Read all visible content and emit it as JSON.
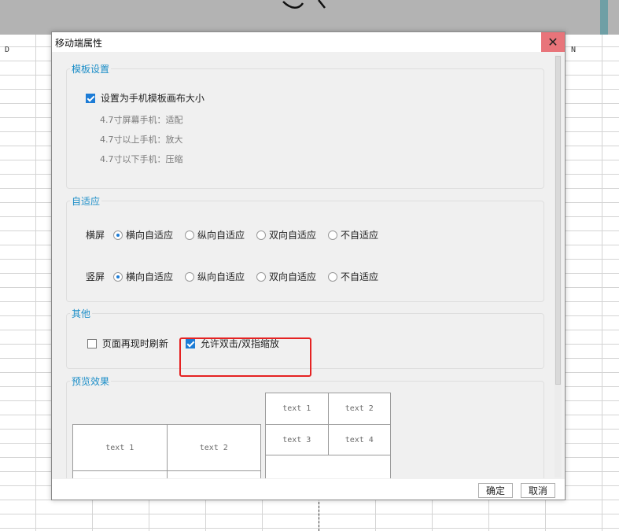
{
  "background": {
    "columns": {
      "d": "D",
      "n": "N"
    }
  },
  "dialog": {
    "title": "移动端属性",
    "close_glyph": "✕",
    "template": {
      "legend": "模板设置",
      "checkbox_label": "设置为手机模板画布大小",
      "checked": true,
      "hints": [
        "4.7寸屏幕手机：适配",
        "4.7寸以上手机：放大",
        "4.7寸以下手机：压缩"
      ]
    },
    "adaptive": {
      "legend": "自适应",
      "landscape_label": "横屏",
      "portrait_label": "竖屏",
      "options": [
        "横向自适应",
        "纵向自适应",
        "双向自适应",
        "不自适应"
      ],
      "landscape_selected": "横向自适应",
      "portrait_selected": "横向自适应"
    },
    "other": {
      "legend": "其他",
      "refresh_label": "页面再现时刷新",
      "refresh_checked": false,
      "zoom_label": "允许双击/双指缩放",
      "zoom_checked": true
    },
    "preview": {
      "legend": "预览效果",
      "left_table": [
        "text 1",
        "text 2"
      ],
      "right_table": [
        "text 1",
        "text 2",
        "text 3",
        "text 4"
      ]
    },
    "ok_label": "确定",
    "cancel_label": "取消"
  },
  "colors": {
    "accent": "#1c8ec8",
    "check": "#1d7cd6",
    "close": "#e8747a",
    "highlight": "#e52222"
  }
}
